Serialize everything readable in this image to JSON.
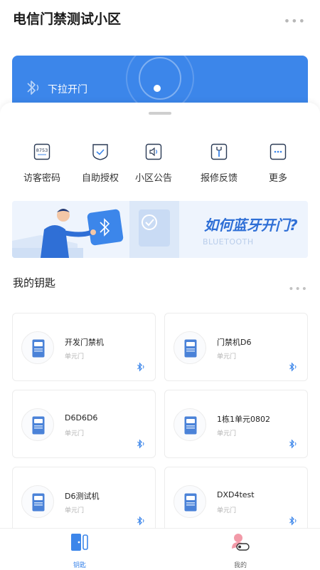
{
  "header": {
    "title": "电信门禁测试小区",
    "more_icon": "ellipsis-icon"
  },
  "banner": {
    "label": "下拉开门",
    "icon": "bluetooth-icon",
    "color": "#3c86ea"
  },
  "quick_actions": [
    {
      "label": "访客密码",
      "icon": "visitor-password-icon",
      "icon_text": "8753"
    },
    {
      "label": "自助授权",
      "icon": "authorize-check-icon"
    },
    {
      "label": "小区公告",
      "icon": "announcement-speaker-icon"
    },
    {
      "label": "报修反馈",
      "icon": "repair-wrench-icon"
    },
    {
      "label": "更多",
      "icon": "more-dots-icon"
    }
  ],
  "promo": {
    "title": "如何蓝牙开门?",
    "subtitle": "BLUETOOTH"
  },
  "keys": {
    "title": "我的钥匙",
    "items": [
      {
        "name": "开发门禁机",
        "type": "单元门"
      },
      {
        "name": "门禁机D6",
        "type": "单元门"
      },
      {
        "name": "D6D6D6",
        "type": "单元门"
      },
      {
        "name": "1栋1单元0802",
        "type": "单元门"
      },
      {
        "name": "D6测试机",
        "type": "单元门"
      },
      {
        "name": "DXD4test",
        "type": "单元门"
      }
    ]
  },
  "tabbar": {
    "tabs": [
      {
        "label": "钥匙",
        "icon": "key-door-icon",
        "active": true
      },
      {
        "label": "我的",
        "icon": "profile-icon",
        "active": false
      }
    ],
    "active_color": "#3c86ea",
    "inactive_color": "#666666"
  }
}
